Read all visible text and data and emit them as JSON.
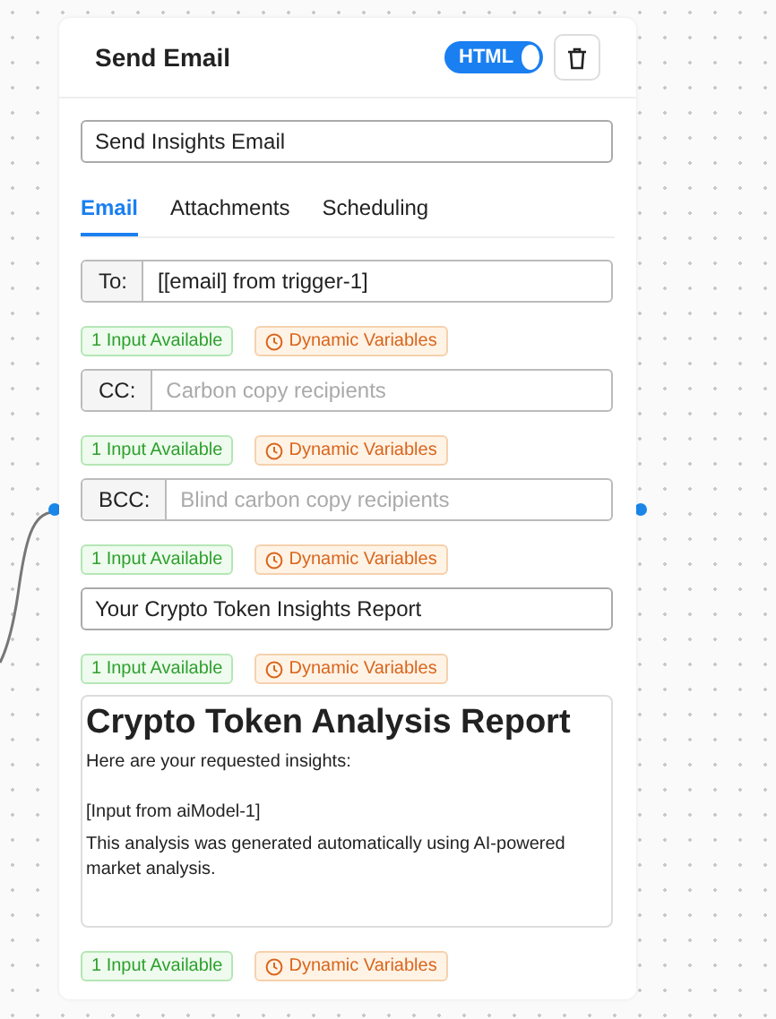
{
  "node": {
    "title": "Send Email",
    "html_toggle": {
      "label": "HTML",
      "on": true
    },
    "name_field": {
      "value": "Send Insights Email"
    },
    "tabs": [
      {
        "label": "Email",
        "selected": true
      },
      {
        "label": "Attachments",
        "selected": false
      },
      {
        "label": "Scheduling",
        "selected": false
      }
    ],
    "sections": [
      {
        "kind": "recipient",
        "label": "To:",
        "value": "[[email] from trigger-1]",
        "badges": {
          "inputs": "1 Input Available",
          "variables": "Dynamic Variables"
        }
      },
      {
        "kind": "recipient",
        "label": "CC:",
        "placeholder": "Carbon copy recipients",
        "badges": {
          "inputs": "1 Input Available",
          "variables": "Dynamic Variables"
        }
      },
      {
        "kind": "recipient",
        "label": "BCC:",
        "placeholder": "Blind carbon copy recipients",
        "badges": {
          "inputs": "1 Input Available",
          "variables": "Dynamic Variables"
        }
      },
      {
        "kind": "subject",
        "value": "Your Crypto Token Insights Report",
        "badges": {
          "inputs": "1 Input Available",
          "variables": "Dynamic Variables"
        }
      },
      {
        "kind": "body",
        "heading": "Crypto Token Analysis Report",
        "paragraphs": [
          "Here are your requested insights:",
          "[Input from aiModel-1]",
          "This analysis was generated automatically using AI-powered market analysis."
        ],
        "badges": {
          "inputs": "1 Input Available",
          "variables": "Dynamic Variables"
        }
      }
    ]
  }
}
